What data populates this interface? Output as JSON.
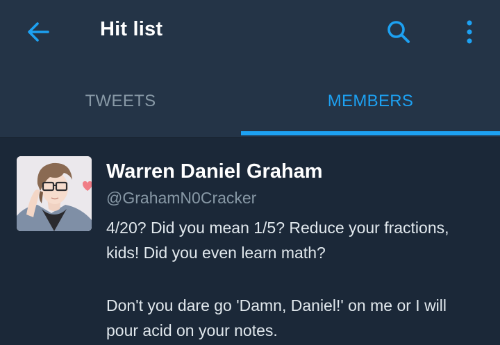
{
  "appbar": {
    "title": "Hit list",
    "back_icon": "arrow-left-icon",
    "search_icon": "search-icon",
    "more_icon": "more-vertical-icon"
  },
  "tabs": [
    {
      "label": "TWEETS",
      "selected": false
    },
    {
      "label": "MEMBERS",
      "selected": true
    }
  ],
  "colors": {
    "accent": "#1da1f2",
    "appbar_bg": "#243447",
    "content_bg": "#1b2838",
    "muted_text": "#8899a6"
  },
  "members": [
    {
      "name": "Warren Daniel Graham",
      "handle": "@GrahamN0Cracker",
      "bio_lines": [
        "4/20? Did you mean 1/5? Reduce your fractions,",
        "kids! Did you even learn math?",
        "",
        "Don't you dare go 'Damn, Daniel!' on me or I will",
        "pour acid on your notes."
      ]
    }
  ]
}
